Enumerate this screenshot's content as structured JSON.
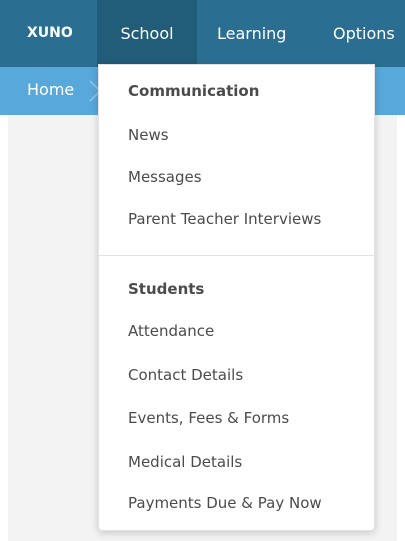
{
  "nav": {
    "brand": "XUNO",
    "items": [
      {
        "label": "School"
      },
      {
        "label": "Learning"
      },
      {
        "label": "Options"
      }
    ],
    "active_index": 0
  },
  "breadcrumb": {
    "home": "Home"
  },
  "dropdown": {
    "sections": [
      {
        "heading": "Communication",
        "items": [
          {
            "label": "News"
          },
          {
            "label": "Messages"
          },
          {
            "label": "Parent Teacher Interviews"
          }
        ]
      },
      {
        "heading": "Students",
        "items": [
          {
            "label": "Attendance"
          },
          {
            "label": "Contact Details"
          },
          {
            "label": "Events, Fees & Forms"
          },
          {
            "label": "Medical Details"
          },
          {
            "label": "Payments Due & Pay Now"
          }
        ]
      }
    ]
  },
  "colors": {
    "nav_bg": "#2a6f92",
    "nav_active_bg": "#215c79",
    "subbar_bg": "#58a8db",
    "page_bg": "#f3f3f3",
    "menu_text": "#4b4b4b"
  },
  "icons": {
    "breadcrumb_separator": "chevron-right-icon"
  }
}
